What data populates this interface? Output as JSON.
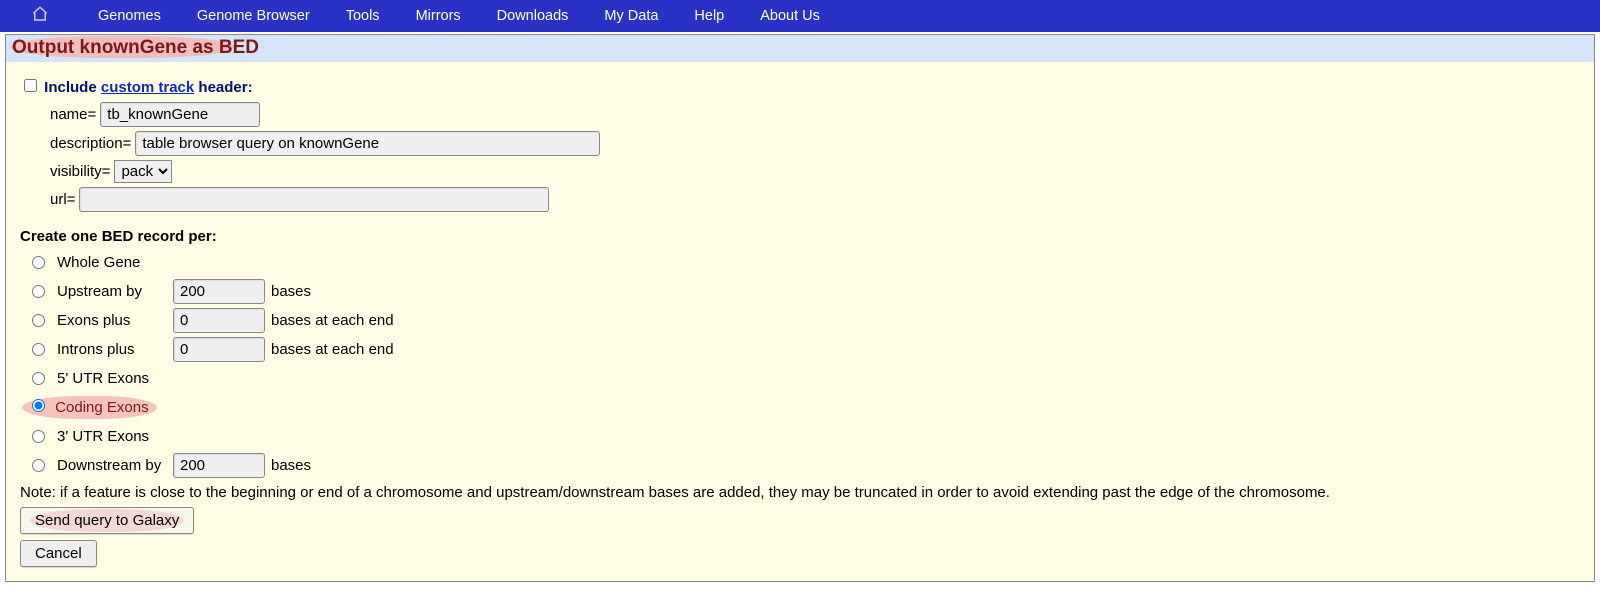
{
  "nav": {
    "items": [
      "Genomes",
      "Genome Browser",
      "Tools",
      "Mirrors",
      "Downloads",
      "My Data",
      "Help",
      "About Us"
    ]
  },
  "page_title": "Output knownGene as BED",
  "include": {
    "label_prefix": "Include ",
    "link_text": "custom track",
    "label_suffix": " header:",
    "checked": false
  },
  "fields": {
    "name_label": "name=",
    "name_value": "tb_knownGene",
    "description_label": "description=",
    "description_value": "table browser query on knownGene",
    "visibility_label": "visibility=",
    "visibility_value": "pack",
    "url_label": "url=",
    "url_value": ""
  },
  "section_heading": "Create one BED record per:",
  "options": {
    "whole_gene": "Whole Gene",
    "upstream": {
      "label": "Upstream by",
      "value": "200",
      "suffix": "bases"
    },
    "exons_plus": {
      "label": "Exons plus",
      "value": "0",
      "suffix": "bases at each end"
    },
    "introns_plus": {
      "label": "Introns plus",
      "value": "0",
      "suffix": "bases at each end"
    },
    "utr5": "5' UTR Exons",
    "coding": "Coding Exons",
    "utr3": "3' UTR Exons",
    "downstream": {
      "label": "Downstream by",
      "value": "200",
      "suffix": "bases"
    }
  },
  "note": "Note: if a feature is close to the beginning or end of a chromosome and upstream/downstream bases are added, they may be truncated in order to avoid extending past the edge of the chromosome.",
  "buttons": {
    "send": "Send query to Galaxy",
    "cancel": "Cancel"
  }
}
